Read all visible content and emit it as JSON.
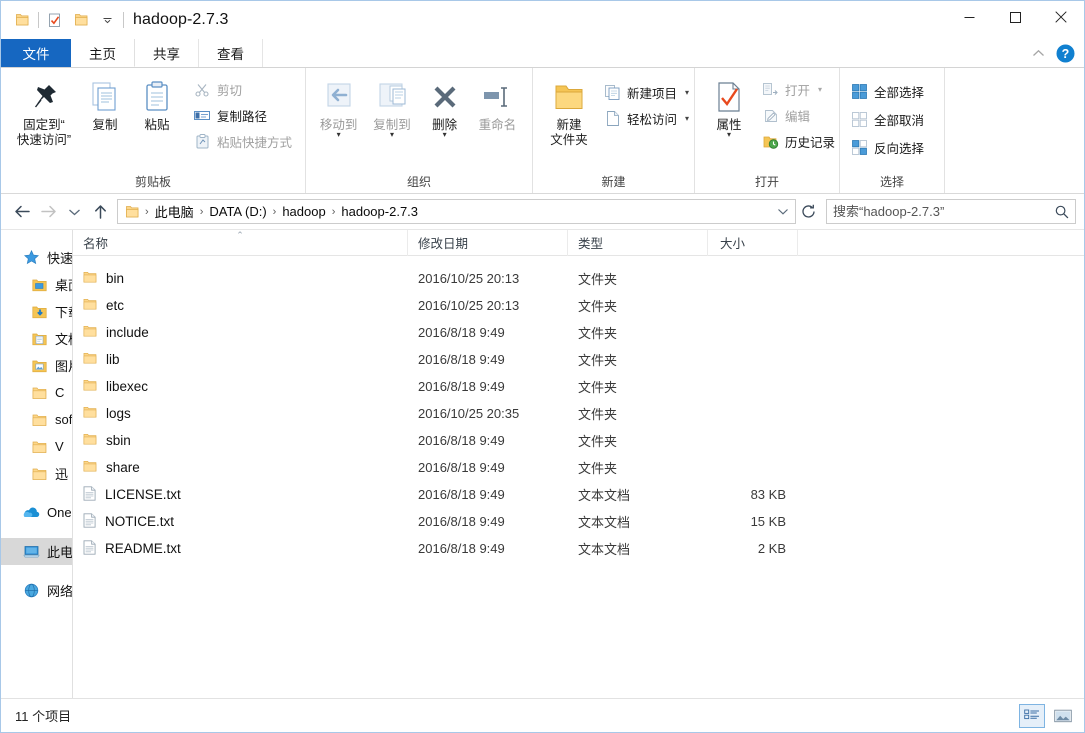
{
  "window": {
    "title": "hadoop-2.7.3",
    "quick_access": [
      {
        "name": "folder-icon",
        "label": ""
      },
      {
        "name": "properties-icon",
        "label": ""
      },
      {
        "name": "new-folder-icon",
        "label": ""
      },
      {
        "name": "chevron-down-icon",
        "label": "▾"
      }
    ],
    "controls": {
      "minimize": "─",
      "maximize": "□",
      "close": "✕",
      "collapse_ribbon": "⌃",
      "help": "?"
    }
  },
  "tabs": [
    {
      "label": "文件",
      "id": "file"
    },
    {
      "label": "主页",
      "id": "home"
    },
    {
      "label": "共享",
      "id": "share"
    },
    {
      "label": "查看",
      "id": "view"
    }
  ],
  "ribbon": {
    "groups": [
      {
        "label": "剪贴板",
        "big_buttons": [
          {
            "label": "固定到“\n快速访问”",
            "icon": "pin-icon",
            "disabled": false
          },
          {
            "label": "复制",
            "icon": "copy-icon",
            "disabled": false
          },
          {
            "label": "粘贴",
            "icon": "paste-icon",
            "disabled": false
          }
        ],
        "small_buttons": [
          {
            "label": "剪切",
            "icon": "scissors-icon",
            "disabled": true
          },
          {
            "label": "复制路径",
            "icon": "copy-path-icon",
            "disabled": false
          },
          {
            "label": "粘贴快捷方式",
            "icon": "paste-shortcut-icon",
            "disabled": true
          }
        ]
      },
      {
        "label": "组织",
        "big_buttons": [
          {
            "label": "移动到",
            "icon": "move-to-icon",
            "disabled": true,
            "caret": true
          },
          {
            "label": "复制到",
            "icon": "copy-to-icon",
            "disabled": true,
            "caret": true
          },
          {
            "label": "删除",
            "icon": "delete-icon",
            "disabled": false,
            "caret": true
          },
          {
            "label": "重命名",
            "icon": "rename-icon",
            "disabled": true
          }
        ],
        "small_buttons": []
      },
      {
        "label": "新建",
        "big_buttons": [
          {
            "label": "新建\n文件夹",
            "icon": "new-folder-icon",
            "disabled": false
          }
        ],
        "small_buttons": [
          {
            "label": "新建项目",
            "icon": "new-item-icon",
            "disabled": false,
            "caret": true
          },
          {
            "label": "轻松访问",
            "icon": "easy-access-icon",
            "disabled": false,
            "caret": true
          }
        ]
      },
      {
        "label": "打开",
        "big_buttons": [
          {
            "label": "属性",
            "icon": "properties-icon",
            "disabled": false,
            "caret": true
          }
        ],
        "small_buttons": [
          {
            "label": "打开",
            "icon": "open-icon",
            "disabled": true,
            "caret": true
          },
          {
            "label": "编辑",
            "icon": "edit-icon",
            "disabled": true
          },
          {
            "label": "历史记录",
            "icon": "history-icon",
            "disabled": false
          }
        ]
      },
      {
        "label": "选择",
        "big_buttons": [],
        "small_buttons": [
          {
            "label": "全部选择",
            "icon": "select-all-icon",
            "disabled": false
          },
          {
            "label": "全部取消",
            "icon": "select-none-icon",
            "disabled": false
          },
          {
            "label": "反向选择",
            "icon": "invert-selection-icon",
            "disabled": false
          }
        ]
      }
    ]
  },
  "address": {
    "back_icon": "←",
    "forward_icon": "→",
    "recent_icon": "⌄",
    "up_icon": "↑",
    "breadcrumbs": [
      "此电脑",
      "DATA (D:)",
      "hadoop",
      "hadoop-2.7.3"
    ],
    "separator": "›",
    "dropdown_icon": "⌄",
    "refresh_icon": "↻"
  },
  "search": {
    "placeholder": "搜索“hadoop-2.7.3”",
    "value": "",
    "icon": "search-icon"
  },
  "navpane": {
    "items": [
      {
        "label": "快速访问",
        "icon": "star-icon",
        "level": 0,
        "selected": false
      },
      {
        "label": "桌面",
        "icon": "desktop-folder-icon",
        "level": 1,
        "selected": false
      },
      {
        "label": "下载",
        "icon": "downloads-folder-icon",
        "level": 1,
        "selected": false
      },
      {
        "label": "文档",
        "icon": "documents-folder-icon",
        "level": 1,
        "selected": false
      },
      {
        "label": "图片",
        "icon": "pictures-folder-icon",
        "level": 1,
        "selected": false
      },
      {
        "label": "C",
        "icon": "folder-icon",
        "level": 1,
        "selected": false
      },
      {
        "label": "sof",
        "icon": "folder-icon",
        "level": 1,
        "selected": false
      },
      {
        "label": "V",
        "icon": "folder-icon",
        "level": 1,
        "selected": false
      },
      {
        "label": "迅",
        "icon": "folder-icon",
        "level": 1,
        "selected": false
      },
      {
        "label": "OneDrive",
        "icon": "onedrive-icon",
        "level": 0,
        "selected": false
      },
      {
        "label": "此电脑",
        "icon": "this-pc-icon",
        "level": 0,
        "selected": true
      },
      {
        "label": "网络",
        "icon": "network-icon",
        "level": 0,
        "selected": false
      }
    ]
  },
  "filelist": {
    "columns": [
      {
        "label": "名称",
        "key": "name",
        "sorted": "asc"
      },
      {
        "label": "修改日期",
        "key": "date",
        "sorted": ""
      },
      {
        "label": "类型",
        "key": "type",
        "sorted": ""
      },
      {
        "label": "大小",
        "key": "size",
        "sorted": ""
      }
    ],
    "sort_indicator": "⌃",
    "rows": [
      {
        "name": "bin",
        "date": "2016/10/25 20:13",
        "type": "文件夹",
        "size": "",
        "icon": "folder-icon"
      },
      {
        "name": "etc",
        "date": "2016/10/25 20:13",
        "type": "文件夹",
        "size": "",
        "icon": "folder-icon"
      },
      {
        "name": "include",
        "date": "2016/8/18 9:49",
        "type": "文件夹",
        "size": "",
        "icon": "folder-icon"
      },
      {
        "name": "lib",
        "date": "2016/8/18 9:49",
        "type": "文件夹",
        "size": "",
        "icon": "folder-icon"
      },
      {
        "name": "libexec",
        "date": "2016/8/18 9:49",
        "type": "文件夹",
        "size": "",
        "icon": "folder-icon"
      },
      {
        "name": "logs",
        "date": "2016/10/25 20:35",
        "type": "文件夹",
        "size": "",
        "icon": "folder-icon"
      },
      {
        "name": "sbin",
        "date": "2016/8/18 9:49",
        "type": "文件夹",
        "size": "",
        "icon": "folder-icon"
      },
      {
        "name": "share",
        "date": "2016/8/18 9:49",
        "type": "文件夹",
        "size": "",
        "icon": "folder-icon"
      },
      {
        "name": "LICENSE.txt",
        "date": "2016/8/18 9:49",
        "type": "文本文档",
        "size": "83 KB",
        "icon": "text-file-icon"
      },
      {
        "name": "NOTICE.txt",
        "date": "2016/8/18 9:49",
        "type": "文本文档",
        "size": "15 KB",
        "icon": "text-file-icon"
      },
      {
        "name": "README.txt",
        "date": "2016/8/18 9:49",
        "type": "文本文档",
        "size": "2 KB",
        "icon": "text-file-icon"
      }
    ]
  },
  "statusbar": {
    "item_count": "11 个项目",
    "views": [
      {
        "name": "details-view-button",
        "active": true
      },
      {
        "name": "large-icons-view-button",
        "active": false
      }
    ]
  },
  "colors": {
    "accent": "#1667c1",
    "selection": "#cce3f7",
    "folder": "#ffd177",
    "help_blue": "#1080d0"
  }
}
